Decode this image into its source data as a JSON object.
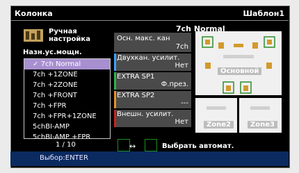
{
  "header": {
    "title": "Колонка",
    "template": "Шаблон1"
  },
  "preset_panel": {
    "label_line1": "Ручная",
    "label_line2": "настройка",
    "section_label": "Назн.ус.мощн.",
    "items": [
      {
        "label": "7ch Normal",
        "selected": true
      },
      {
        "label": "7ch +1ZONE",
        "selected": false
      },
      {
        "label": "7ch +2ZONE",
        "selected": false
      },
      {
        "label": "7ch +FRONT",
        "selected": false
      },
      {
        "label": "7ch +FPR",
        "selected": false
      },
      {
        "label": "7ch +FPR+1ZONE",
        "selected": false
      },
      {
        "label": "5chBI-AMP",
        "selected": false
      },
      {
        "label": "5chBI-AMP +FPR",
        "selected": false
      }
    ],
    "page": "1 / 10"
  },
  "details": {
    "preset_name": "7ch Normal",
    "rows": [
      {
        "label": "Осн. макс. кан",
        "value": "7ch",
        "accent": ""
      },
      {
        "label": "Двухкан. усилит.",
        "value": "Нет",
        "accent": "#3aa3ff"
      },
      {
        "label": "EXTRA SP1",
        "value": "Ф.през.",
        "accent": "#2fb34a"
      },
      {
        "label": "EXTRA SP2",
        "value": "---",
        "accent": "#e78f28"
      },
      {
        "label": "Внешн. усилит.",
        "value": "Нет",
        "accent": "#d02020"
      }
    ]
  },
  "diagram": {
    "main_label": "Основной",
    "zone2_label": "Zone2",
    "zone3_label": "Zone3"
  },
  "auto_select": {
    "label": "Выбрать автомат."
  },
  "footer": {
    "hint": "Выбор:ENTER"
  },
  "colors": {
    "selection": "#a88fd0",
    "footer_bg": "#0b2a60"
  }
}
